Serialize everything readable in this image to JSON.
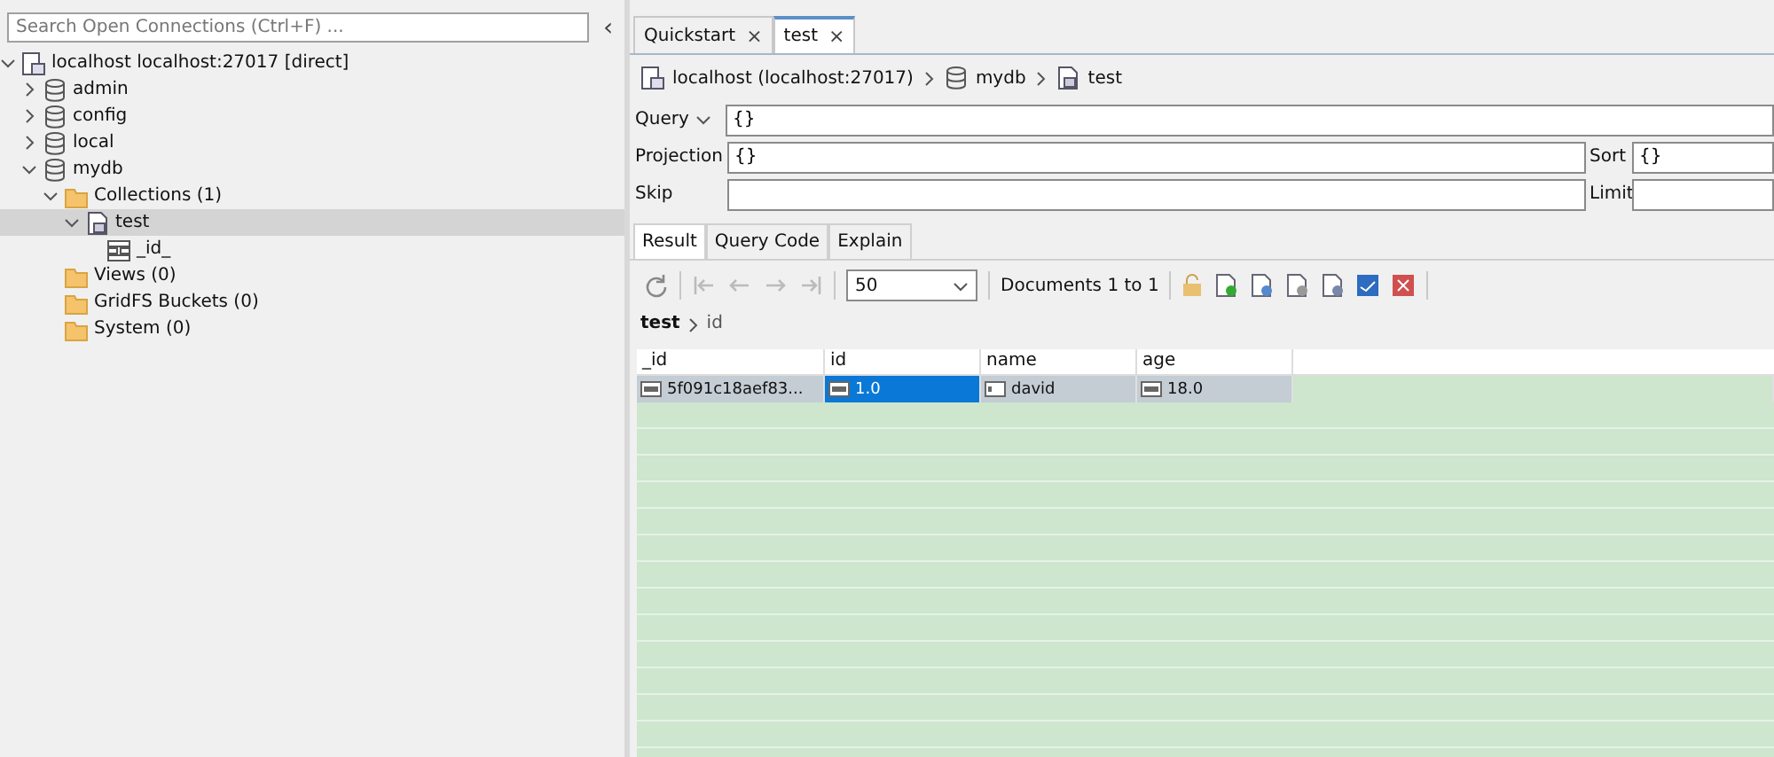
{
  "search": {
    "placeholder": "Search Open Connections (Ctrl+F) ..."
  },
  "collapse_button": "‹",
  "tree": [
    {
      "label": "localhost localhost:27017 [direct]",
      "expanded": true,
      "selected": false,
      "children": [
        {
          "label": "admin",
          "expanded": false,
          "selected": false
        },
        {
          "label": "config",
          "expanded": false,
          "selected": false
        },
        {
          "label": "local",
          "expanded": false,
          "selected": false
        },
        {
          "label": "mydb",
          "expanded": true,
          "selected": false,
          "children": [
            {
              "label": "Collections (1)",
              "expanded": true,
              "selected": false,
              "children": [
                {
                  "label": "test",
                  "expanded": true,
                  "selected": true,
                  "children": [
                    {
                      "label": "_id_",
                      "selected": false
                    }
                  ]
                }
              ]
            },
            {
              "label": "Views (0)",
              "selected": false
            },
            {
              "label": "GridFS Buckets (0)",
              "selected": false
            },
            {
              "label": "System (0)",
              "selected": false
            }
          ]
        }
      ]
    }
  ],
  "tabs": [
    {
      "label": "Quickstart",
      "close": "×",
      "selected": false
    },
    {
      "label": "test",
      "close": "×",
      "selected": true
    }
  ],
  "breadcrumb": [
    {
      "label": "localhost (localhost:27017)"
    },
    {
      "label": "mydb"
    },
    {
      "label": "test"
    }
  ],
  "query": {
    "label": "Query",
    "value": "{}"
  },
  "projection": {
    "label": "Projection",
    "value": "{}"
  },
  "sort": {
    "label": "Sort",
    "value": "{}"
  },
  "skip": {
    "label": "Skip"
  },
  "limit": {
    "label": "Limit"
  },
  "result_tabs": [
    {
      "label": "Result",
      "selected": true
    },
    {
      "label": "Query Code",
      "selected": false
    },
    {
      "label": "Explain",
      "selected": false
    }
  ],
  "toolbar": {
    "page_size": "50",
    "documents": "Documents 1 to 1"
  },
  "path": {
    "root": "test",
    "field": "id"
  },
  "grid": {
    "columns": [
      "_id",
      "id",
      "name",
      "age"
    ],
    "rows": [
      {
        "selected": true,
        "cells": [
          {
            "kind": "objectid",
            "value": "5f091c18aef83...",
            "selected": false
          },
          {
            "kind": "number",
            "value": "1.0",
            "selected": true
          },
          {
            "kind": "string",
            "value": "david",
            "selected": false
          },
          {
            "kind": "number",
            "value": "18.0",
            "selected": false
          }
        ]
      }
    ]
  }
}
